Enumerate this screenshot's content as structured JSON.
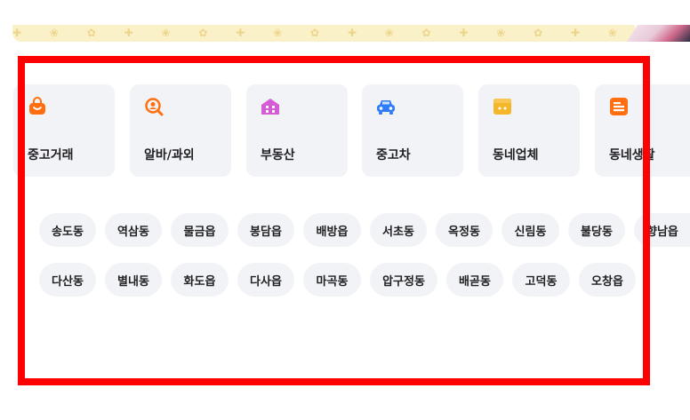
{
  "categories": [
    {
      "label": "중고거래",
      "icon": "shopping-bag-icon",
      "color": "#ff6f0f"
    },
    {
      "label": "알바/과외",
      "icon": "search-person-icon",
      "color": "#ff6f0f"
    },
    {
      "label": "부동산",
      "icon": "house-icon",
      "color": "#d65bd6"
    },
    {
      "label": "중고차",
      "icon": "car-icon",
      "color": "#2f7cf6"
    },
    {
      "label": "동네업체",
      "icon": "store-icon",
      "color": "#f5b72a"
    },
    {
      "label": "동네생활",
      "icon": "document-icon",
      "color": "#ff6f0f"
    }
  ],
  "neighborhoods": {
    "row1": [
      "송도동",
      "역삼동",
      "물금읍",
      "봉담읍",
      "배방읍",
      "서초동",
      "옥정동",
      "신림동",
      "불당동",
      "향남읍"
    ],
    "row2": [
      "다산동",
      "별내동",
      "화도읍",
      "다사읍",
      "마곡동",
      "압구정동",
      "배곧동",
      "고덕동",
      "오창읍"
    ]
  },
  "colors": {
    "card_bg": "#f2f3f6",
    "highlight": "#ff0000",
    "banner": "#fbf1c8"
  }
}
